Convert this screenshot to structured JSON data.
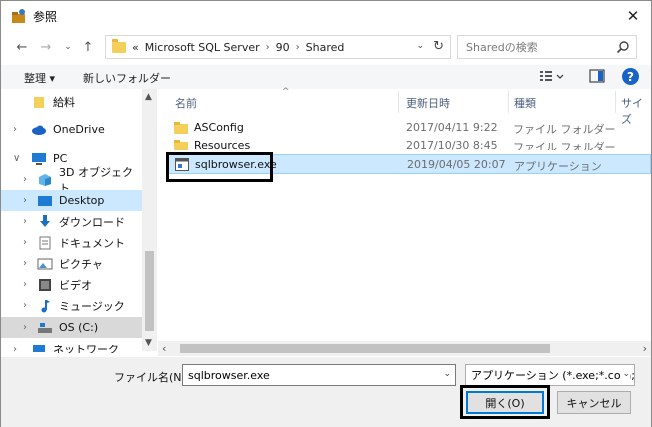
{
  "window": {
    "title": "参照",
    "close_glyph": "✕"
  },
  "address": {
    "prefix": "«",
    "crumbs": [
      "Microsoft SQL Server",
      "90",
      "Shared"
    ],
    "separator": "›"
  },
  "search": {
    "placeholder": "Sharedの検索"
  },
  "toolbar": {
    "organize_label": "整理 ▾",
    "new_folder_label": "新しいフォルダー",
    "help_glyph": "?"
  },
  "nav": {
    "items": [
      {
        "label": "給料",
        "arrow": ""
      },
      {
        "label": "OneDrive",
        "arrow": "›"
      },
      {
        "label": "PC",
        "arrow": "∨"
      },
      {
        "label": "3D オブジェクト",
        "arrow": "›"
      },
      {
        "label": "Desktop",
        "arrow": "›"
      },
      {
        "label": "ダウンロード",
        "arrow": "›"
      },
      {
        "label": "ドキュメント",
        "arrow": "›"
      },
      {
        "label": "ピクチャ",
        "arrow": "›"
      },
      {
        "label": "ビデオ",
        "arrow": "›"
      },
      {
        "label": "ミュージック",
        "arrow": "›"
      },
      {
        "label": "OS (C:)",
        "arrow": "›"
      },
      {
        "label": "ネットワーク",
        "arrow": "›"
      }
    ]
  },
  "columns": {
    "name": "名前",
    "date": "更新日時",
    "type": "種類",
    "size": "サイズ"
  },
  "files": [
    {
      "name": "ASConfig",
      "date": "2017/04/11 9:22",
      "type": "ファイル フォルダー"
    },
    {
      "name": "Resources",
      "date": "2017/10/30 8:45",
      "type": "ファイル フォルダー"
    },
    {
      "name": "sqlbrowser.exe",
      "date": "2019/04/05 20:07",
      "type": "アプリケーション"
    }
  ],
  "footer": {
    "filename_label": "ファイル名(N):",
    "filename_value": "sqlbrowser.exe",
    "filter_value": "アプリケーション (*.exe;*.com;*.icd",
    "open_label": "開く(O)",
    "cancel_label": "キャンセル"
  },
  "colors": {
    "accent": "#0078d7",
    "selection": "#cce8ff",
    "folder": "#f4cf5a"
  }
}
